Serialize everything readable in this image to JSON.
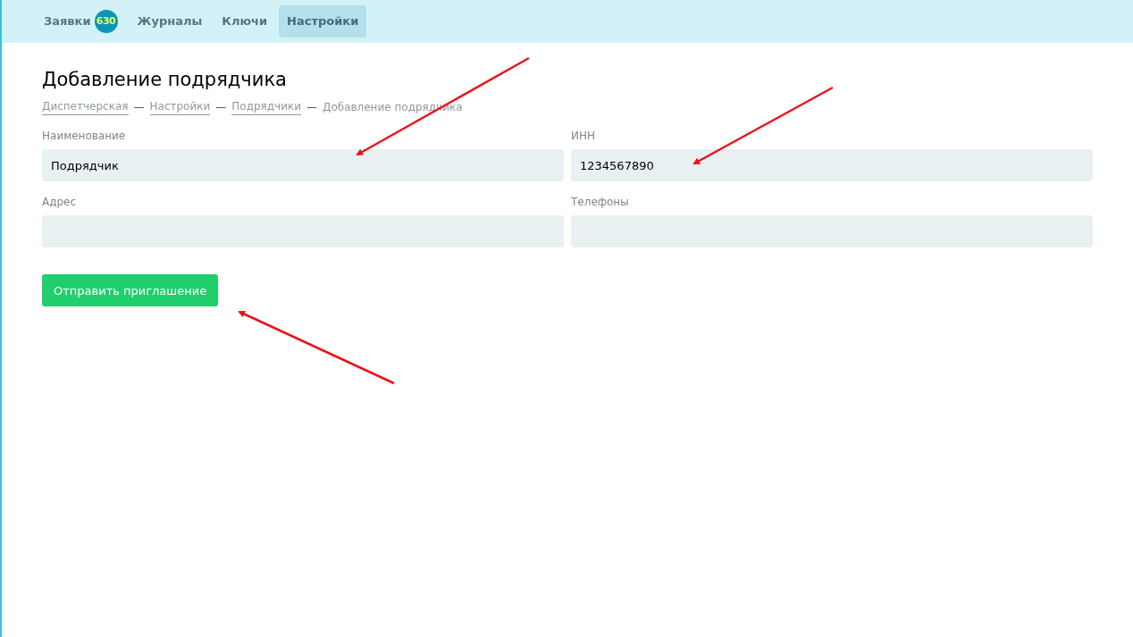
{
  "nav": [
    {
      "label": "Заявки",
      "badge": "630",
      "selected": false
    },
    {
      "label": "Журналы",
      "selected": false
    },
    {
      "label": "Ключи",
      "selected": false
    },
    {
      "label": "Настройки",
      "selected": true
    }
  ],
  "page_title": "Добавление подрядчика",
  "breadcrumbs": [
    {
      "label": "Диспетчерская",
      "kind": "link"
    },
    {
      "label": "Настройки",
      "kind": "link"
    },
    {
      "label": "Подрядчики",
      "kind": "link"
    },
    {
      "label": "Добавление подрядчика",
      "kind": "current"
    }
  ],
  "separator": "—",
  "fields": [
    {
      "label": "Наименование",
      "value": "Подрядчик"
    },
    {
      "label": "ИНН",
      "value": "1234567890"
    },
    {
      "label": "Адрес"
    },
    {
      "label": "Телефоны"
    }
  ],
  "submit_button": "Отправить приглашение"
}
